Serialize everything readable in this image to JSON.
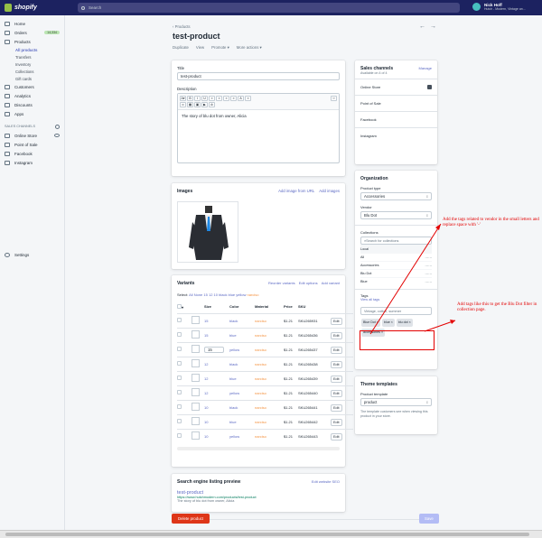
{
  "topbar": {
    "logo_text": "shopify",
    "search_placeholder": "Search",
    "user_name": "Nick Hoff",
    "user_store": "Hutch - Modern, Vintage an..."
  },
  "sidebar": {
    "items": [
      {
        "label": "Home",
        "icon": "home-icon"
      },
      {
        "label": "Orders",
        "icon": "orders-icon",
        "badge": "14,334"
      },
      {
        "label": "Products",
        "icon": "products-icon"
      }
    ],
    "product_subitems": [
      "All products",
      "Transfers",
      "Inventory",
      "Collections",
      "Gift cards"
    ],
    "items2": [
      {
        "label": "Customers",
        "icon": "customers-icon"
      },
      {
        "label": "Analytics",
        "icon": "analytics-icon"
      },
      {
        "label": "Discounts",
        "icon": "discounts-icon"
      },
      {
        "label": "Apps",
        "icon": "apps-icon"
      }
    ],
    "channels_heading": "SALES CHANNELS",
    "channels": [
      "Online Store",
      "Point of Sale",
      "Facebook",
      "Instagram"
    ],
    "settings": "Settings"
  },
  "header": {
    "back": "‹ Products",
    "title": "test-product",
    "actions": [
      "Duplicate",
      "View",
      "Promote ▾",
      "More actions ▾"
    ]
  },
  "product": {
    "title_label": "Title",
    "title_value": "test-product",
    "description_label": "Description",
    "description_value": "The story of blu dot from owner, Alicia"
  },
  "images": {
    "heading": "Images",
    "add_url": "Add image from URL",
    "add_images": "Add images"
  },
  "variants": {
    "heading": "Variants",
    "reorder": "Reorder variants",
    "edit_options": "Edit options",
    "add_variant": "Add variant",
    "select_label": "Select:",
    "select_options": [
      "All",
      "None",
      "15",
      "12",
      "10",
      "black",
      "blue",
      "yellow",
      "narciso"
    ],
    "columns": [
      "Size",
      "Color",
      "Material",
      "Price",
      "SKU"
    ],
    "rows": [
      {
        "size": "15",
        "color": "black",
        "material": "narciso",
        "price": "$1.21",
        "sku": "SKU265931"
      },
      {
        "size": "15",
        "color": "blue",
        "material": "narciso",
        "price": "$1.21",
        "sku": "SKU265436"
      },
      {
        "size": "15",
        "color": "yellow",
        "material": "narciso",
        "price": "$1.21",
        "sku": "SKU265437"
      },
      {
        "size": "12",
        "color": "black",
        "material": "narciso",
        "price": "$1.21",
        "sku": "SKU265438"
      },
      {
        "size": "12",
        "color": "blue",
        "material": "narciso",
        "price": "$1.21",
        "sku": "SKU265439"
      },
      {
        "size": "12",
        "color": "yellow",
        "material": "narciso",
        "price": "$1.21",
        "sku": "SKU265440"
      },
      {
        "size": "10",
        "color": "black",
        "material": "narciso",
        "price": "$1.21",
        "sku": "SKU265441"
      },
      {
        "size": "10",
        "color": "blue",
        "material": "narciso",
        "price": "$1.21",
        "sku": "SKU265442"
      },
      {
        "size": "10",
        "color": "yellow",
        "material": "narciso",
        "price": "$1.21",
        "sku": "SKU265443"
      }
    ],
    "edit_label": "Edit"
  },
  "seo": {
    "heading": "Search engine listing preview",
    "edit": "Edit website SEO",
    "title": "test-product",
    "url": "https://www.hutchmodern.com/products/test-product",
    "desc": "The story of blu dot from owner, Alicia"
  },
  "footer": {
    "delete": "Delete product",
    "save": "Save"
  },
  "sales_channels": {
    "heading": "Sales channels",
    "manage": "Manage",
    "available": "Available on 4 of 4",
    "items": [
      "Online Store",
      "Point of Sale",
      "Facebook",
      "Instagram"
    ]
  },
  "organization": {
    "heading": "Organization",
    "type_label": "Product type",
    "type_value": "Accessories",
    "vendor_label": "Vendor",
    "vendor_value": "Blu Dot",
    "collections_label": "Collections",
    "collections_search": "Search for collections",
    "collections": [
      "Local",
      "All",
      "Accessories",
      "Blu Dot",
      "Blue"
    ],
    "tags_label": "Tags",
    "view_all_tags": "View all tags",
    "tags_placeholder": "Vintage, cotton, summer",
    "tags": [
      "Blue Dot",
      "blue",
      "blu dot",
      "accessories"
    ]
  },
  "theme": {
    "heading": "Theme templates",
    "template_label": "Product template",
    "template_value": "product",
    "desc": "The template customers see when viewing this product in your store."
  },
  "annotations": {
    "note1": "Add the tags related to vendor in the small letters and replace space with '-'",
    "note2": "Add tags like this to get the Blu Dot filter in collection page."
  },
  "colors": {
    "nav": "#1c2260",
    "accent": "#5c6ac4",
    "delete": "#de3618",
    "annotation": "#e30000"
  }
}
